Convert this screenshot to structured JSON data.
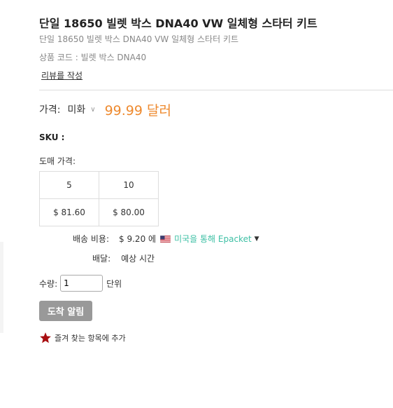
{
  "product": {
    "title": "단일 18650 빌렛 박스 DNA40 VW 일체형 스타터 키트",
    "subtitle": "단일 18650 빌렛 박스 DNA40 VW 일체형 스타터 키트",
    "product_code": "상품 코드 : 빌렛 박스 DNA40",
    "review_link": "리뷰를 작성"
  },
  "price": {
    "label": "가격:",
    "currency": "미화",
    "value": "99.99 달러"
  },
  "sku": {
    "label": "SKU :"
  },
  "wholesale": {
    "label": "도매 가격:",
    "quantities": [
      "5",
      "10"
    ],
    "prices": [
      "$ 81.60",
      "$ 80.00"
    ]
  },
  "shipping": {
    "label": "배송 비용:",
    "cost": "$ 9.20 에",
    "method": "미국을 통해 Epacket",
    "flag_icon": "us-flag-icon"
  },
  "delivery": {
    "label": "배달:",
    "value": "예상 시간"
  },
  "quantity": {
    "label": "수량:",
    "value": "1",
    "unit": "단위"
  },
  "notify_button": "도착 알림",
  "favorites": {
    "label": "즐겨 찾는 항목에 추가",
    "icon": "star-icon",
    "icon_color": "#a80d10"
  },
  "colors": {
    "price": "#ee8a2f",
    "shipping_method": "#3ec0a5",
    "button_bg": "#999999"
  }
}
